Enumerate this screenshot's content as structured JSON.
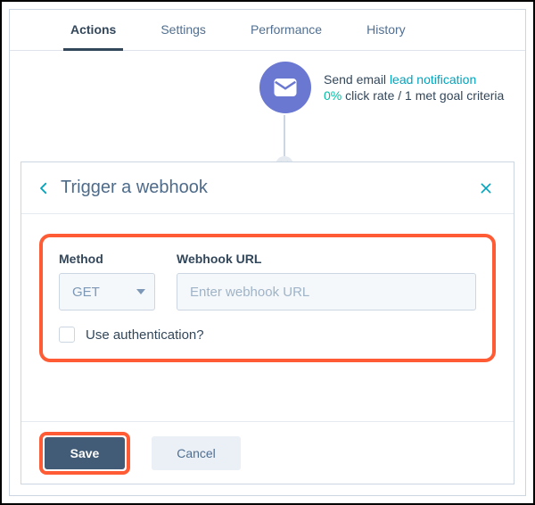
{
  "tabs": {
    "items": [
      "Actions",
      "Settings",
      "Performance",
      "History"
    ],
    "activeIndex": 0
  },
  "node": {
    "action_prefix": "Send email",
    "link": "lead notification",
    "stat_pct": "0%",
    "stat_rest": " click rate / 1 met goal criteria"
  },
  "panel": {
    "title": "Trigger a webhook",
    "method_label": "Method",
    "method_value": "GET",
    "url_label": "Webhook URL",
    "url_placeholder": "Enter webhook URL",
    "url_value": "",
    "auth_label": "Use authentication?",
    "save_label": "Save",
    "cancel_label": "Cancel"
  }
}
